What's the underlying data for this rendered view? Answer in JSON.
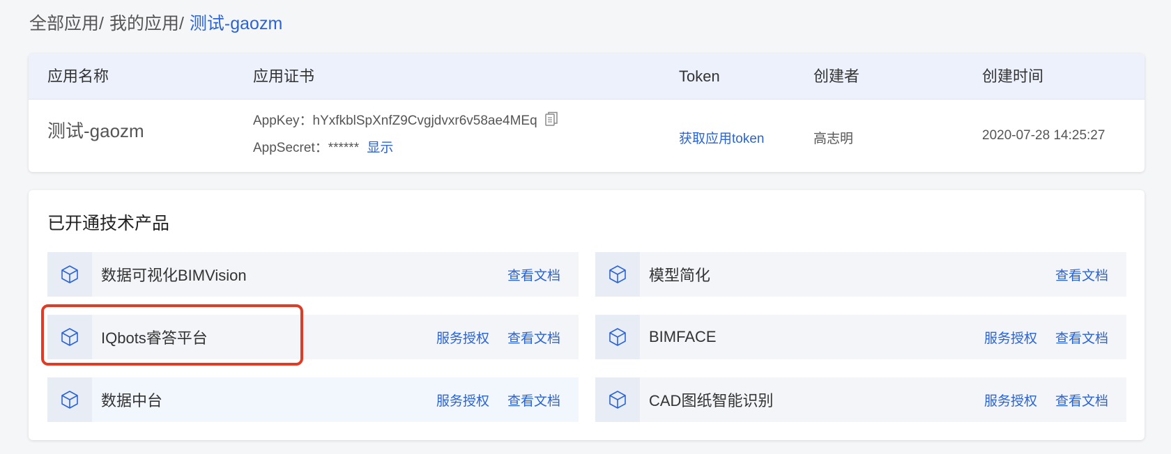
{
  "breadcrumb": {
    "items": [
      "全部应用/",
      "我的应用/"
    ],
    "current": "测试-gaozm"
  },
  "app_table": {
    "headers": [
      "应用名称",
      "应用证书",
      "Token",
      "创建者",
      "创建时间"
    ],
    "row": {
      "name": "测试-gaozm",
      "appkey_label": "AppKey：hYxfkblSpXnfZ9Cvgjdvxr6v58ae4MEq",
      "appsecret_label": "AppSecret：******",
      "show_link": "显示",
      "token_link": "获取应用token",
      "creator": "高志明",
      "created_time": "2020-07-28 14:25:27"
    }
  },
  "products": {
    "title": "已开通技术产品",
    "items": [
      {
        "name": "数据可视化BIMVision",
        "auth": "",
        "doc": "查看文档"
      },
      {
        "name": "模型简化",
        "auth": "",
        "doc": "查看文档"
      },
      {
        "name": "IQbots睿答平台",
        "auth": "服务授权",
        "doc": "查看文档"
      },
      {
        "name": "BIMFACE",
        "auth": "服务授权",
        "doc": "查看文档"
      },
      {
        "name": "数据中台",
        "auth": "服务授权",
        "doc": "查看文档"
      },
      {
        "name": "CAD图纸智能识别",
        "auth": "服务授权",
        "doc": "查看文档"
      }
    ]
  },
  "colors": {
    "accent": "#2a63d6",
    "highlight": "#e23b25",
    "header_bg": "#edf1fc"
  },
  "icons": {
    "copy": "copy-icon",
    "product": "cube-icon"
  }
}
